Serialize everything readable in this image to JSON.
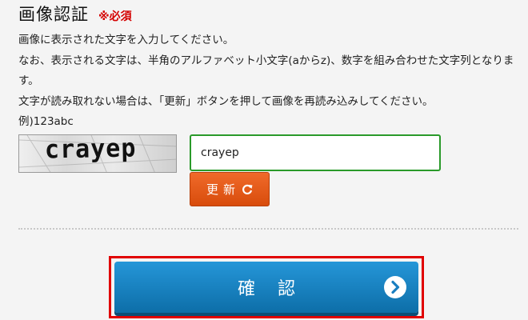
{
  "section": {
    "title": "画像認証",
    "required": "※必須"
  },
  "description": {
    "line1": "画像に表示された文字を入力してください。",
    "line2": "なお、表示される文字は、半角のアルファベット小文字(aからz)、数字を組み合わせた文字列となります。",
    "line3": "文字が読み取れない場合は、「更新」ボタンを押して画像を再読み込みしてください。",
    "line4": "例)123abc"
  },
  "captcha": {
    "image_text": "crayep",
    "input_value": "crayep"
  },
  "buttons": {
    "refresh_label": "更新",
    "confirm_label": "確認"
  },
  "colors": {
    "input_border": "#2a9a2a",
    "refresh_bg": "#e85a18",
    "confirm_bg": "#1a83c2",
    "highlight_frame": "#e00000",
    "required_text": "#d40000"
  },
  "icons": {
    "refresh": "refresh-icon",
    "confirm": "chevron-right-circle-icon"
  }
}
